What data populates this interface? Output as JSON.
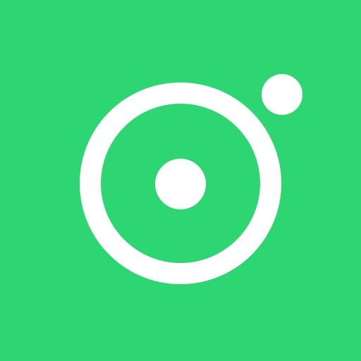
{
  "icon": {
    "name": "ring-camera-logo-icon",
    "colors": {
      "background": "#2ED573",
      "foreground": "#FFFFFF"
    }
  }
}
